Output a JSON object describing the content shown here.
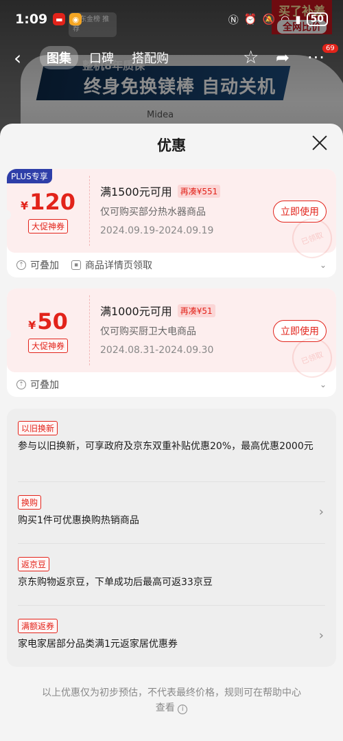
{
  "status_bar": {
    "time": "1:09",
    "battery": "50"
  },
  "background": {
    "rank_badge": "京东金榜 推荐",
    "banner_sub": "整机8年质保",
    "banner_main": "终身免换镁棒 自动关机",
    "brand": "Midea",
    "red_tag_line1": "买了补差",
    "red_tag_line2": "全网比价"
  },
  "nav": {
    "back_icon": "chevron-left-icon",
    "tabs": [
      "图集",
      "口碑",
      "搭配购"
    ],
    "badge_count": "69"
  },
  "sheet": {
    "title": "优惠",
    "close_icon": "close-icon"
  },
  "coupons": [
    {
      "plus_badge": "PLUS专享",
      "currency": "¥",
      "amount": "120",
      "tag": "大促神券",
      "condition": "满1500元可用",
      "extra": "再凑¥551",
      "scope": "仅可购买部分热水器商品",
      "dates": "2024.09.19-2024.09.19",
      "button": "立即使用",
      "stamp": "已领取",
      "foot": [
        "可叠加",
        "商品详情页领取"
      ]
    },
    {
      "plus_badge": "",
      "currency": "¥",
      "amount": "50",
      "tag": "大促神券",
      "condition": "满1000元可用",
      "extra": "再凑¥51",
      "scope": "仅可购买厨卫大电商品",
      "dates": "2024.08.31-2024.09.30",
      "button": "立即使用",
      "stamp": "已领取",
      "foot": [
        "可叠加"
      ]
    }
  ],
  "promos": [
    {
      "tag": "以旧换新",
      "text": "参与以旧换新，可享政府及京东双重补贴优惠20%，最高优惠2000元",
      "has_arrow": false
    },
    {
      "tag": "换购",
      "text": "购买1件可优惠换购热销商品",
      "has_arrow": true
    },
    {
      "tag": "返京豆",
      "text": "京东购物返京豆，下单成功后最高可返33京豆",
      "has_arrow": false
    },
    {
      "tag": "满额返券",
      "text": "家电家居部分品类满1元返家居优惠券",
      "has_arrow": true
    }
  ],
  "footnote": "以上优惠仅为初步预估，不代表最终价格，规则可在帮助中心查看",
  "colors": {
    "accent_red": "#e2231a",
    "plus_blue": "#2e3ea8",
    "coupon_bg": "#fdeeee"
  }
}
